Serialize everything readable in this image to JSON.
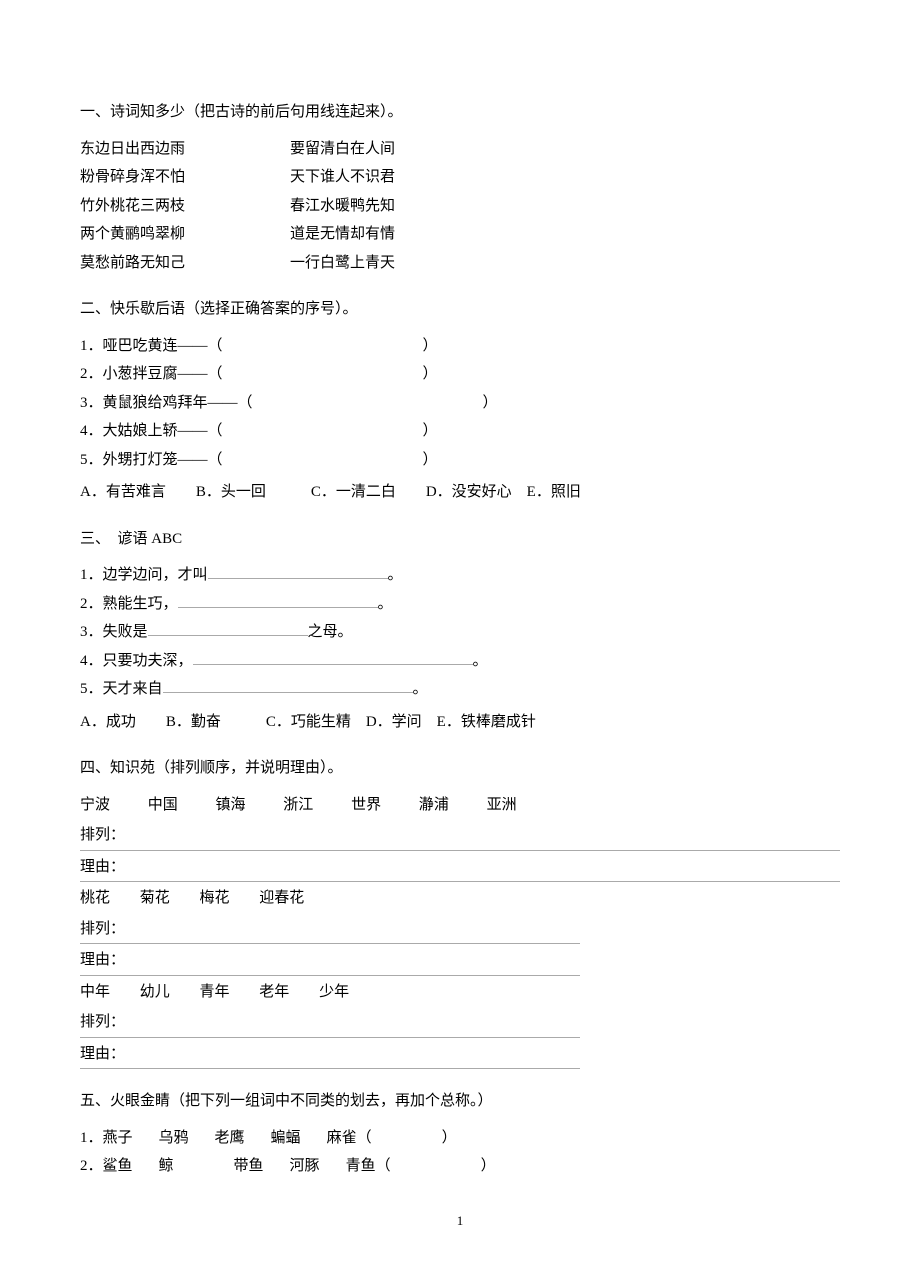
{
  "s1": {
    "title": "一、诗词知多少（把古诗的前后句用线连起来）。",
    "rows": [
      {
        "left": "东边日出西边雨",
        "right": "要留清白在人间"
      },
      {
        "left": "粉骨碎身浑不怕",
        "right": "天下谁人不识君"
      },
      {
        "left": "竹外桃花三两枝",
        "right": "春江水暖鸭先知"
      },
      {
        "left": "两个黄鹂鸣翠柳",
        "right": "道是无情却有情"
      },
      {
        "left": "莫愁前路无知己",
        "right": "一行白鹭上青天"
      }
    ]
  },
  "s2": {
    "title": "二、快乐歇后语（选择正确答案的序号）。",
    "items": [
      "1．哑巴吃黄连——（",
      "2．小葱拌豆腐——（",
      "3．黄鼠狼给鸡拜年——（",
      "4．大姑娘上轿——（",
      "5．外甥打灯笼——（"
    ],
    "close": "）",
    "options": "A．有苦难言　　B．头一回　　　C．一清二白　　D．没安好心　E．照旧"
  },
  "s3": {
    "title": "三、　谚语 ABC",
    "l1a": " 1．边学边问，才叫",
    "l1b": "。",
    "l2a": "2．熟能生巧，",
    "l2b": "。",
    "l3a": "3．失败是",
    "l3b": "之母。",
    "l4a": "4．只要功夫深，",
    "l4b": "。",
    "l5a": "5．天才来自",
    "l5b": "。",
    "options": "A．成功　　B．勤奋　　　C．巧能生精　D．学问　E．铁棒磨成针"
  },
  "s4": {
    "title": "四、知识苑（排列顺序，并说明理由）。",
    "arrangeLabel": "排列：",
    "reasonLabel": "理由：",
    "g1": [
      "宁波",
      "中国",
      "镇海",
      "浙江",
      "世界",
      "瀞浦",
      "亚洲"
    ],
    "g2": [
      "桃花",
      "菊花",
      "梅花",
      "迎春花"
    ],
    "g3": [
      "中年",
      "幼儿",
      "青年",
      "老年",
      "少年"
    ]
  },
  "s5": {
    "title": "五、火眼金睛（把下列一组词中不同类的划去，再加个总称。）",
    "r1": [
      " 1．燕子",
      "乌鸦",
      "老鹰",
      "蝙蝠",
      "麻雀（"
    ],
    "r2": [
      "2．鲨鱼",
      "鲸",
      "带鱼",
      "河豚",
      "青鱼（"
    ],
    "close": "）"
  },
  "pageNum": "1"
}
